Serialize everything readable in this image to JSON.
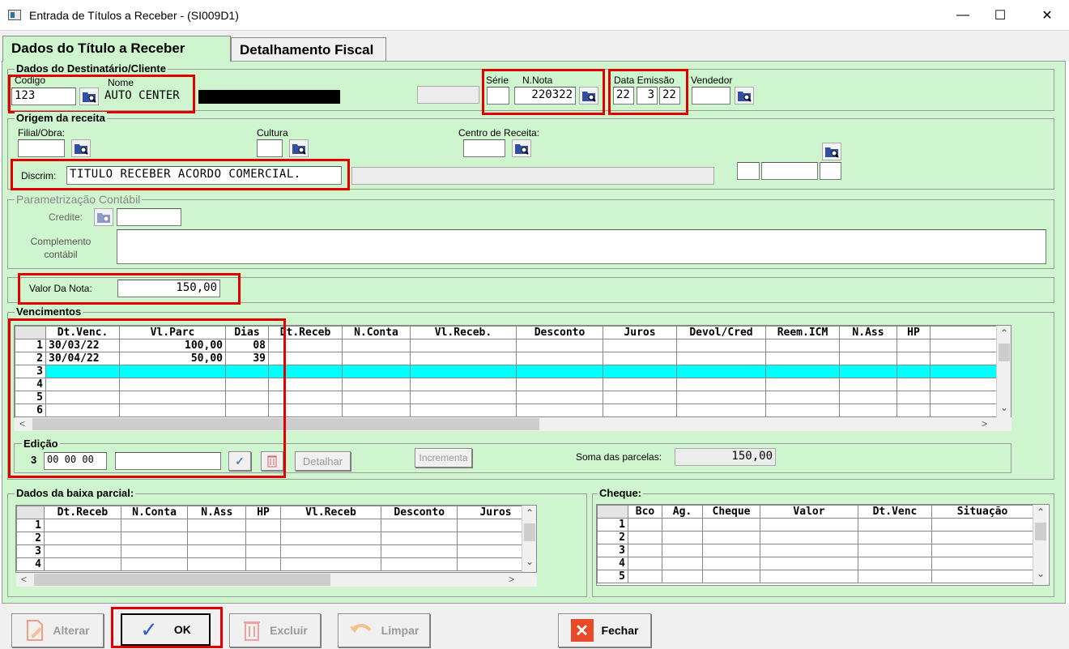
{
  "window": {
    "title": "Entrada de Títulos a Receber - (SI009D1)"
  },
  "tabs": [
    "Dados do Título a Receber",
    "Detalhamento Fiscal"
  ],
  "dest": {
    "group": "Dados do Destinatário/Cliente",
    "codigo_label": "Codigo",
    "codigo": "123",
    "nome_label": "Nome",
    "nome": "AUTO CENTER",
    "serie_label": "Série",
    "nnota_label": "N.Nota",
    "nnota": "220322",
    "data_label": "Data Emissão",
    "dia": "22",
    "mes": "3",
    "ano": "22",
    "vendedor_label": "Vendedor"
  },
  "origem": {
    "group": "Origem da receita",
    "filial_label": "Filial/Obra:",
    "cultura_label": "Cultura",
    "centro_label": "Centro de Receita:",
    "discrim_label": "Discrim:",
    "discrim": "TITULO RECEBER ACORDO COMERCIAL."
  },
  "param": {
    "group": "Parametrização Contábil",
    "credite_label": "Credite:",
    "complemento_label": "Complemento contábil"
  },
  "valor": {
    "label": "Valor Da Nota:",
    "value": "150,00"
  },
  "venc": {
    "group": "Vencimentos",
    "headers": [
      "",
      "Dt.Venc.",
      "Vl.Parc",
      "Dias",
      "Dt.Receb",
      "N.Conta",
      "Vl.Receb.",
      "Desconto",
      "Juros",
      "Devol/Cred",
      "Reem.ICM",
      "N.Ass",
      "HP",
      ""
    ],
    "rows": [
      [
        "1",
        "30/03/22",
        "100,00",
        "08"
      ],
      [
        "2",
        "30/04/22",
        "50,00",
        "39"
      ],
      [
        "3",
        "",
        "",
        ""
      ],
      [
        "4",
        "",
        "",
        ""
      ],
      [
        "5",
        "",
        "",
        ""
      ],
      [
        "6",
        "",
        "",
        ""
      ]
    ]
  },
  "edicao": {
    "group": "Edição",
    "row": "3",
    "date": "00 00 00",
    "detalhar": "Detalhar",
    "incrementa": "Incrementa",
    "soma_label": "Soma das parcelas:",
    "soma": "150,00"
  },
  "baixa": {
    "group": "Dados da baixa parcial:",
    "headers": [
      "",
      "Dt.Receb",
      "N.Conta",
      "N.Ass",
      "HP",
      "Vl.Receb",
      "Desconto",
      "Juros"
    ],
    "rows": [
      "1",
      "2",
      "3",
      "4"
    ]
  },
  "cheque": {
    "group": "Cheque:",
    "headers": [
      "",
      "Bco",
      "Ag.",
      "Cheque",
      "Valor",
      "Dt.Venc",
      "Situação"
    ],
    "rows": [
      "1",
      "2",
      "3",
      "4",
      "5"
    ]
  },
  "buttons": {
    "alterar": "Alterar",
    "ok": "OK",
    "excluir": "Excluir",
    "limpar": "Limpar",
    "fechar": "Fechar"
  }
}
